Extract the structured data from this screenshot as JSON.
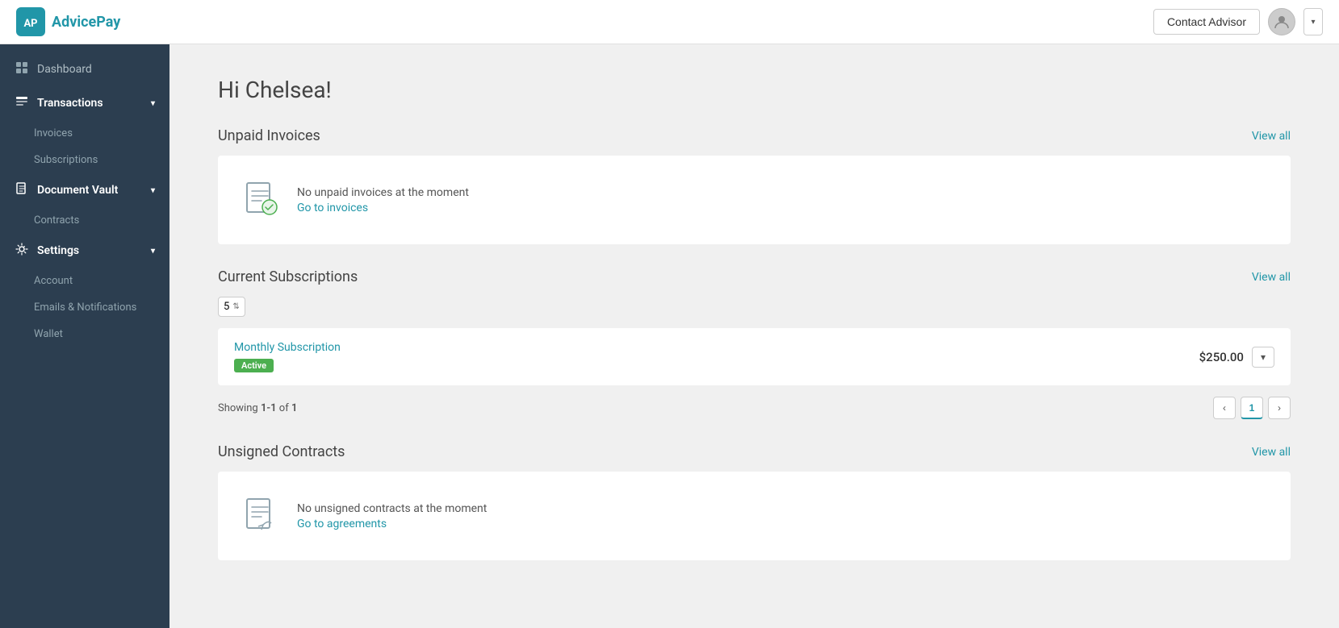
{
  "app": {
    "name": "AdvicePay",
    "logo_letter": "AP"
  },
  "header": {
    "contact_advisor_label": "Contact Advisor",
    "user_initial": ""
  },
  "sidebar": {
    "items": [
      {
        "id": "dashboard",
        "label": "Dashboard",
        "icon": "⊞",
        "type": "top",
        "expanded": false
      },
      {
        "id": "transactions",
        "label": "Transactions",
        "icon": "💳",
        "type": "section",
        "expanded": true
      },
      {
        "id": "invoices",
        "label": "Invoices",
        "type": "sub"
      },
      {
        "id": "subscriptions",
        "label": "Subscriptions",
        "type": "sub"
      },
      {
        "id": "document-vault",
        "label": "Document Vault",
        "icon": "📄",
        "type": "section",
        "expanded": true
      },
      {
        "id": "contracts",
        "label": "Contracts",
        "type": "sub"
      },
      {
        "id": "settings",
        "label": "Settings",
        "icon": "⚙",
        "type": "section",
        "expanded": true
      },
      {
        "id": "account",
        "label": "Account",
        "type": "sub"
      },
      {
        "id": "emails-notifications",
        "label": "Emails & Notifications",
        "type": "sub"
      },
      {
        "id": "wallet",
        "label": "Wallet",
        "type": "sub"
      }
    ]
  },
  "main": {
    "greeting": "Hi Chelsea!",
    "sections": {
      "unpaid_invoices": {
        "title": "Unpaid Invoices",
        "view_all": "View all",
        "empty_message": "No unpaid invoices at the moment",
        "empty_link": "Go to invoices"
      },
      "current_subscriptions": {
        "title": "Current Subscriptions",
        "view_all": "View all",
        "per_page": "5",
        "subscriptions": [
          {
            "name": "Monthly Subscription",
            "status": "Active",
            "amount": "$250.00"
          }
        ],
        "showing_text": "Showing",
        "showing_range": "1-1",
        "showing_of": "of",
        "showing_total": "1",
        "current_page": "1"
      },
      "unsigned_contracts": {
        "title": "Unsigned Contracts",
        "view_all": "View all",
        "empty_message": "No unsigned contracts at the moment",
        "empty_link": "Go to agreements"
      }
    }
  }
}
